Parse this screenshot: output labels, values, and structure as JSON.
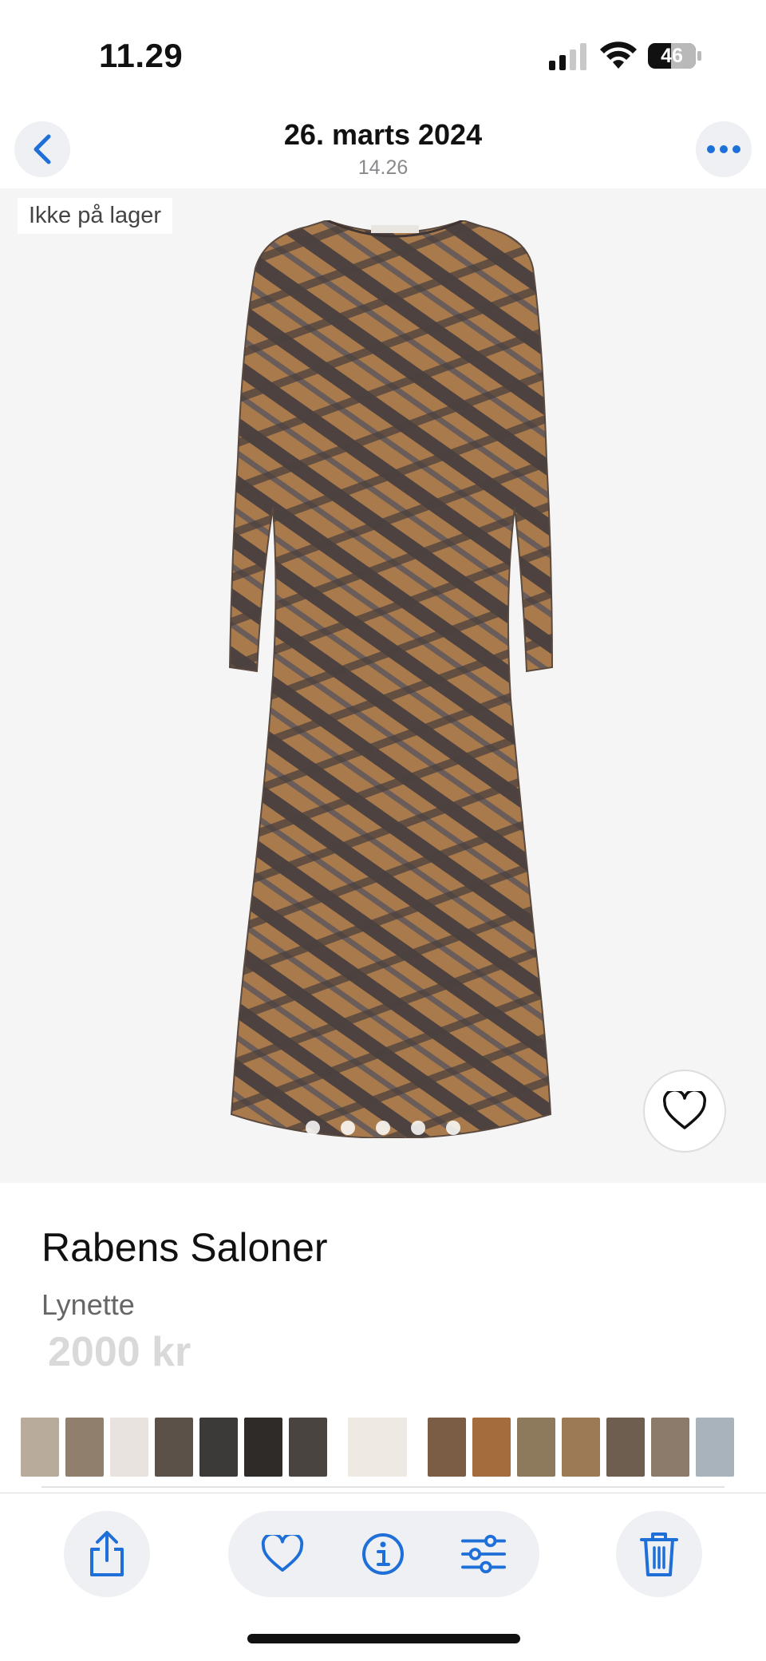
{
  "status": {
    "time": "11.29",
    "battery": "46"
  },
  "nav": {
    "title": "26. marts 2024",
    "subtitle": "14.26"
  },
  "product": {
    "stock_label": "Ikke på lager",
    "brand": "Rabens Saloner",
    "model": "Lynette",
    "price": "2000 kr",
    "image_dots": 5
  },
  "thumbnails": [
    {
      "color": "#b8ab9b"
    },
    {
      "color": "#8f7f6c"
    },
    {
      "color": "#e8e3de"
    },
    {
      "color": "#5b5148"
    },
    {
      "color": "#3c3a38"
    },
    {
      "color": "#2f2b28"
    },
    {
      "color": "#4a4440"
    },
    {
      "color": "#efe9e4",
      "selected": true
    },
    {
      "color": "#7b5c44"
    },
    {
      "color": "#a46b3c"
    },
    {
      "color": "#8d7a5c"
    },
    {
      "color": "#9c7a56"
    },
    {
      "color": "#6e5e4f"
    },
    {
      "color": "#8c7b6a"
    },
    {
      "color": "#a9b3bb"
    }
  ],
  "colors": {
    "accent": "#1f6fd8",
    "toolbar_bg": "#eef0f3",
    "photo_bg": "#f5f5f5"
  },
  "icons": {
    "back": "chevron-left-icon",
    "more": "ellipsis-icon",
    "favorite": "heart-icon",
    "share": "share-icon",
    "info": "info-icon",
    "adjust": "sliders-icon",
    "delete": "trash-icon"
  }
}
